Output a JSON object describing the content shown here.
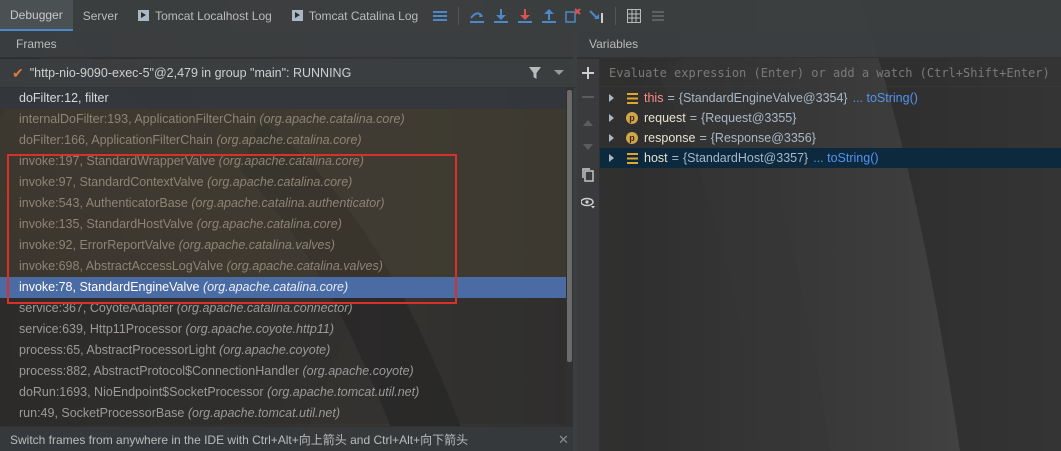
{
  "toolbar": {
    "tabs": [
      "Debugger",
      "Server",
      "Tomcat Localhost Log",
      "Tomcat Catalina Log"
    ],
    "active_tab": "Debugger",
    "accent": "#4a88c7",
    "icons": [
      "restore-layout-icon",
      "show-execution-point-icon",
      "step-over-icon",
      "step-into-icon",
      "force-step-into-icon",
      "step-out-icon",
      "drop-frame-icon",
      "run-to-cursor-icon",
      "evaluate-expression-icon",
      "trace-icon"
    ]
  },
  "frames_panel": {
    "title": "Frames",
    "thread": "\"http-nio-9090-exec-5\"@2,479 in group \"main\": RUNNING",
    "frames": [
      {
        "method": "doFilter:12, filter",
        "pkg": "",
        "kind": "first"
      },
      {
        "method": "internalDoFilter:193, ApplicationFilterChain",
        "pkg": "(org.apache.catalina.core)",
        "kind": "lib"
      },
      {
        "method": "doFilter:166, ApplicationFilterChain",
        "pkg": "(org.apache.catalina.core)",
        "kind": "lib"
      },
      {
        "method": "invoke:197, StandardWrapperValve",
        "pkg": "(org.apache.catalina.core)",
        "kind": "lib"
      },
      {
        "method": "invoke:97, StandardContextValve",
        "pkg": "(org.apache.catalina.core)",
        "kind": "lib"
      },
      {
        "method": "invoke:543, AuthenticatorBase",
        "pkg": "(org.apache.catalina.authenticator)",
        "kind": "lib"
      },
      {
        "method": "invoke:135, StandardHostValve",
        "pkg": "(org.apache.catalina.core)",
        "kind": "lib"
      },
      {
        "method": "invoke:92, ErrorReportValve",
        "pkg": "(org.apache.catalina.valves)",
        "kind": "lib"
      },
      {
        "method": "invoke:698, AbstractAccessLogValve",
        "pkg": "(org.apache.catalina.valves)",
        "kind": "lib"
      },
      {
        "method": "invoke:78, StandardEngineValve",
        "pkg": "(org.apache.catalina.core)",
        "kind": "sel"
      },
      {
        "method": "service:367, CoyoteAdapter",
        "pkg": "(org.apache.catalina.connector)",
        "kind": "plain"
      },
      {
        "method": "service:639, Http11Processor",
        "pkg": "(org.apache.coyote.http11)",
        "kind": "plain"
      },
      {
        "method": "process:65, AbstractProcessorLight",
        "pkg": "(org.apache.coyote)",
        "kind": "plain"
      },
      {
        "method": "process:882, AbstractProtocol$ConnectionHandler",
        "pkg": "(org.apache.coyote)",
        "kind": "plain"
      },
      {
        "method": "doRun:1693, NioEndpoint$SocketProcessor",
        "pkg": "(org.apache.tomcat.util.net)",
        "kind": "plain"
      },
      {
        "method": "run:49, SocketProcessorBase",
        "pkg": "(org.apache.tomcat.util.net)",
        "kind": "plain"
      }
    ],
    "highlight_color": "#d9302a",
    "status_hint": "Switch frames from anywhere in the IDE with Ctrl+Alt+向上箭头 and Ctrl+Alt+向下箭头"
  },
  "variables_panel": {
    "title": "Variables",
    "eval_placeholder": "Evaluate expression (Enter) or add a watch (Ctrl+Shift+Enter)",
    "vars": [
      {
        "name": "this",
        "value": "{StandardEngineValve@3354}",
        "link": "... toString()",
        "icon": "field"
      },
      {
        "name": "request",
        "value": "{Request@3355}",
        "link": "",
        "icon": "p"
      },
      {
        "name": "response",
        "value": "{Response@3356}",
        "link": "",
        "icon": "p"
      },
      {
        "name": "host",
        "value": "{StandardHost@3357}",
        "link": "... toString()",
        "icon": "field"
      }
    ],
    "icon_letter": "p"
  }
}
